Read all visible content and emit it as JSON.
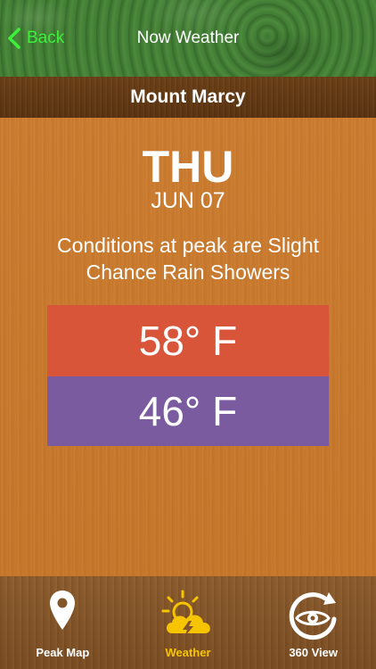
{
  "nav": {
    "back_label": "Back",
    "title": "Now Weather"
  },
  "peak": {
    "name": "Mount Marcy"
  },
  "forecast": {
    "day": "THU",
    "date": "JUN 07",
    "conditions": "Conditions at peak are Slight Chance Rain Showers",
    "high": "58° F",
    "low": "46° F"
  },
  "colors": {
    "back_green": "#3cf03c",
    "high_bg": "#d9553a",
    "low_bg": "#7b5ba0",
    "active_tab": "#f7c400"
  },
  "tabs": [
    {
      "label": "Peak Map",
      "icon": "map-pin-icon",
      "active": false
    },
    {
      "label": "Weather",
      "icon": "sun-cloud-lightning-icon",
      "active": true
    },
    {
      "label": "360 View",
      "icon": "eye-rotate-icon",
      "active": false
    }
  ]
}
